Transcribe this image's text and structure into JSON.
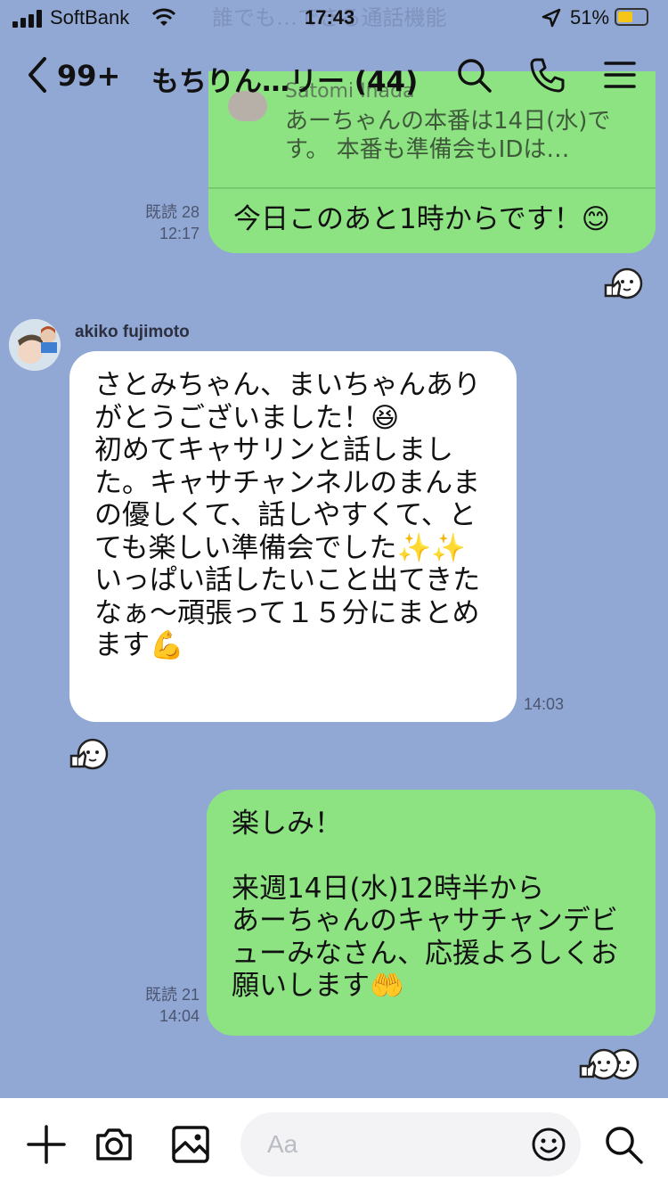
{
  "status_bar": {
    "carrier": "SoftBank",
    "time": "17:43",
    "battery": "51%"
  },
  "header": {
    "unread": "99+",
    "title": "もちりん…リー (44)"
  },
  "messages": [
    {
      "id": "m1",
      "direction": "out",
      "reply_to": {
        "sender": "Satomi Inada",
        "text": "あーちゃんの本番は14日(水)です。 本番も準備会もIDは…"
      },
      "lines": [
        "今日このあと1時からです！😊"
      ],
      "read": "既読 28",
      "time": "12:17"
    },
    {
      "id": "m2",
      "direction": "in",
      "sender": "akiko fujimoto",
      "lines": [
        "さとみちゃん、まいちゃんあり",
        "がとうございました！😆",
        "初めてキャサリンと話しまし",
        "た。キャサチャンネルのまんま",
        "の優しくて、話しやすくて、と",
        "ても楽しい準備会でした✨✨",
        "いっぱい話したいこと出てきた",
        "なぁ〜頑張って１５分にまとめ",
        "ます💪"
      ],
      "time": "14:03"
    },
    {
      "id": "m3",
      "direction": "out",
      "lines": [
        "楽しみ！",
        "",
        "来週14日(水)12時半から",
        "あーちゃんのキャサチャンデビ",
        "ューみなさん、応援よろしくお",
        "願いします🤲"
      ],
      "read": "既読 21",
      "time": "14:04"
    }
  ],
  "background_text": "誰でも…できる通話機能",
  "input": {
    "placeholder": "Aa"
  }
}
